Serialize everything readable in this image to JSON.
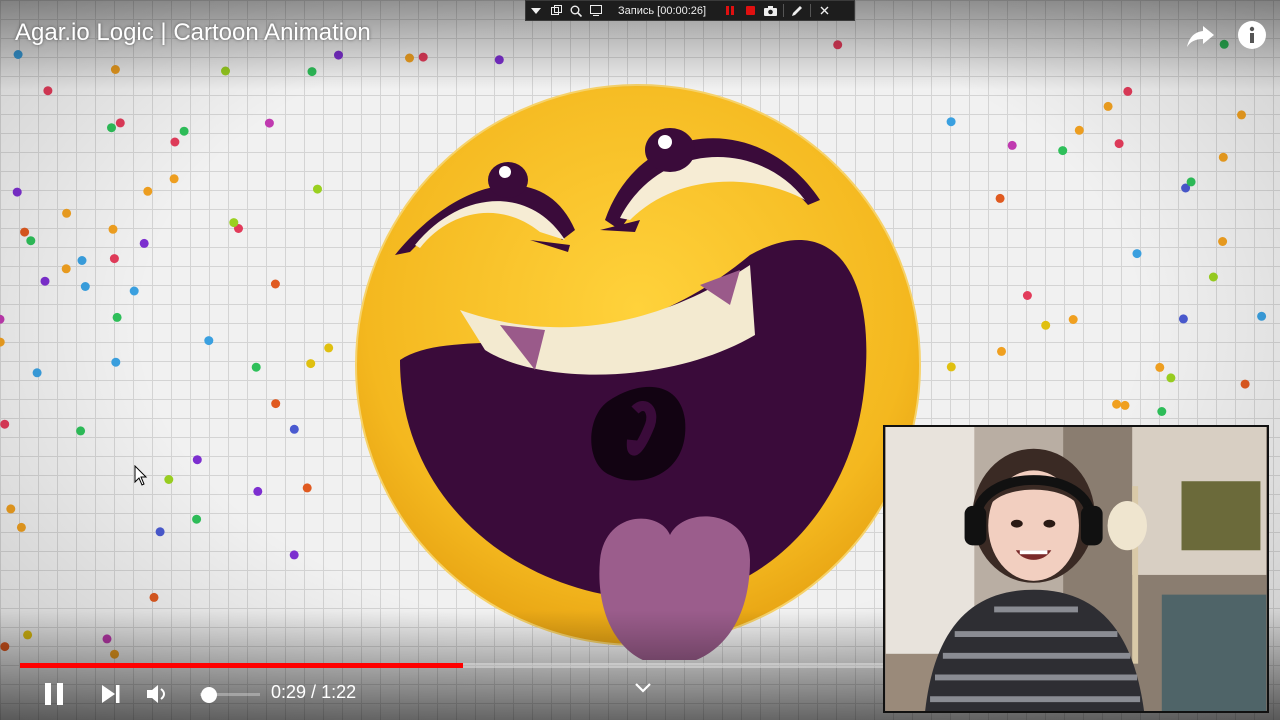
{
  "video": {
    "title": "Agar.io Logic | Cartoon Animation",
    "progress_fraction": 0.357,
    "volume_fraction": 0.15
  },
  "top_controls": {
    "share_icon": "share-arrow-icon",
    "info_icon": "info-icon"
  },
  "recorder": {
    "label": "Запись [00:00:26]",
    "icons": [
      "menu-dropdown-icon",
      "window-icon",
      "zoom-icon",
      "region-icon",
      "pause-icon",
      "stop-icon",
      "camera-icon",
      "pen-icon",
      "close-icon"
    ]
  },
  "player_controls": {
    "current_time": "0:29",
    "separator": " / ",
    "duration": "1:22",
    "icons": [
      "pause-icon",
      "next-icon",
      "volume-icon",
      "chevron-down-icon"
    ]
  },
  "colors": {
    "progress_played": "#ff0000",
    "face_yellow": "#f5c12a",
    "mouth_purple": "#3a0b3a",
    "tongue": "#9b5d8c"
  }
}
